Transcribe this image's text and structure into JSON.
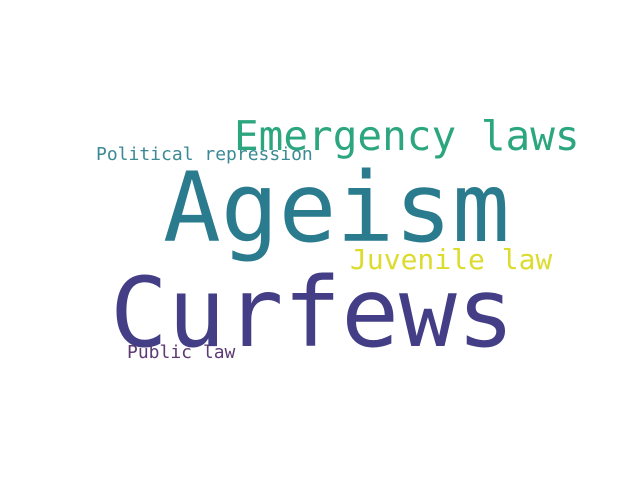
{
  "word_cloud": {
    "words": [
      {
        "id": "curfews",
        "text": "Curfews",
        "color": "#433e85"
      },
      {
        "id": "ageism",
        "text": "Ageism",
        "color": "#2a7b8e"
      },
      {
        "id": "emerg",
        "text": "Emergency laws",
        "color": "#2ca67e"
      },
      {
        "id": "juvenile",
        "text": "Juvenile law",
        "color": "#dcdc2e"
      },
      {
        "id": "polrep",
        "text": "Political repression",
        "color": "#3b8a94"
      },
      {
        "id": "public",
        "text": "Public law",
        "color": "#5c3a73"
      }
    ]
  }
}
